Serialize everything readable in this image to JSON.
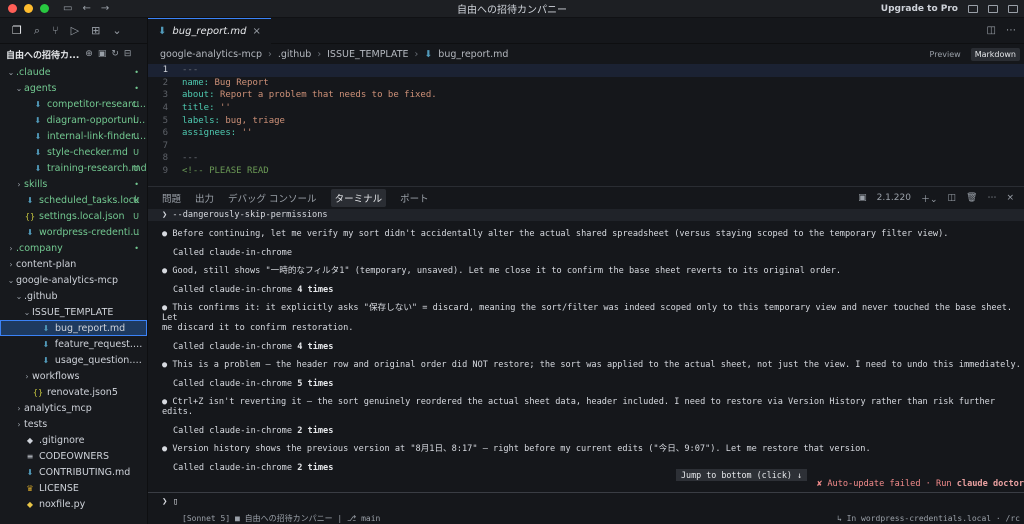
{
  "window": {
    "title": "自由への招待カンパニー",
    "upgrade": "Upgrade to Pro"
  },
  "sidebar": {
    "header": "自由への招待カ...",
    "tree": [
      {
        "name": ".claude",
        "depth": 0,
        "type": "folder",
        "expanded": true,
        "badge": "•"
      },
      {
        "name": "agents",
        "depth": 1,
        "type": "folder",
        "expanded": true,
        "badge": "•"
      },
      {
        "name": "competitor-researc...",
        "depth": 2,
        "type": "md",
        "badge": "U"
      },
      {
        "name": "diagram-opportunit...",
        "depth": 2,
        "type": "md",
        "badge": "U"
      },
      {
        "name": "internal-link-finder....",
        "depth": 2,
        "type": "md",
        "badge": "U"
      },
      {
        "name": "style-checker.md",
        "depth": 2,
        "type": "md",
        "badge": "U"
      },
      {
        "name": "training-research.md",
        "depth": 2,
        "type": "md",
        "badge": "U"
      },
      {
        "name": "skills",
        "depth": 1,
        "type": "folder",
        "expanded": false,
        "badge": "•"
      },
      {
        "name": "scheduled_tasks.lock",
        "depth": 1,
        "type": "md",
        "badge": "U"
      },
      {
        "name": "settings.local.json",
        "depth": 1,
        "type": "json",
        "badge": "U"
      },
      {
        "name": "wordpress-credential...",
        "depth": 1,
        "type": "md",
        "badge": "U"
      },
      {
        "name": ".company",
        "depth": 0,
        "type": "folder",
        "expanded": false,
        "badge": "•"
      },
      {
        "name": "content-plan",
        "depth": 0,
        "type": "folder",
        "expanded": false,
        "badge": ""
      },
      {
        "name": "google-analytics-mcp",
        "depth": 0,
        "type": "folder",
        "expanded": true,
        "badge": ""
      },
      {
        "name": ".github",
        "depth": 1,
        "type": "folder",
        "expanded": true,
        "badge": ""
      },
      {
        "name": "ISSUE_TEMPLATE",
        "depth": 2,
        "type": "folder",
        "expanded": true,
        "badge": ""
      },
      {
        "name": "bug_report.md",
        "depth": 3,
        "type": "md",
        "badge": "",
        "selected": true
      },
      {
        "name": "feature_request.md",
        "depth": 3,
        "type": "md",
        "badge": ""
      },
      {
        "name": "usage_question.md",
        "depth": 3,
        "type": "md",
        "badge": ""
      },
      {
        "name": "workflows",
        "depth": 2,
        "type": "folder",
        "expanded": false,
        "badge": ""
      },
      {
        "name": "renovate.json5",
        "depth": 2,
        "type": "json",
        "badge": ""
      },
      {
        "name": "analytics_mcp",
        "depth": 1,
        "type": "folder",
        "expanded": false,
        "badge": ""
      },
      {
        "name": "tests",
        "depth": 1,
        "type": "folder",
        "expanded": false,
        "badge": ""
      },
      {
        "name": ".gitignore",
        "depth": 1,
        "type": "git",
        "badge": ""
      },
      {
        "name": "CODEOWNERS",
        "depth": 1,
        "type": "plain",
        "badge": ""
      },
      {
        "name": "CONTRIBUTING.md",
        "depth": 1,
        "type": "md",
        "badge": ""
      },
      {
        "name": "LICENSE",
        "depth": 1,
        "type": "license",
        "badge": ""
      },
      {
        "name": "noxfile.py",
        "depth": 1,
        "type": "py",
        "badge": ""
      }
    ]
  },
  "editor": {
    "tab": "bug_report.md",
    "breadcrumb": [
      "google-analytics-mcp",
      ".github",
      "ISSUE_TEMPLATE",
      "bug_report.md"
    ],
    "preview": "Preview",
    "markdown": "Markdown",
    "lines": [
      {
        "n": "1",
        "text": "---"
      },
      {
        "n": "2",
        "key": "name:",
        "val": "Bug Report"
      },
      {
        "n": "3",
        "key": "about:",
        "val": "Report a problem that needs to be fixed."
      },
      {
        "n": "4",
        "key": "title:",
        "val": "''"
      },
      {
        "n": "5",
        "key": "labels:",
        "val": "bug, triage"
      },
      {
        "n": "6",
        "key": "assignees:",
        "val": "''"
      },
      {
        "n": "7",
        "text": ""
      },
      {
        "n": "8",
        "text": "---"
      },
      {
        "n": "9",
        "comment": "<!-- PLEASE READ"
      }
    ]
  },
  "panel": {
    "tabs": [
      "問題",
      "出力",
      "デバッグ コンソール",
      "ターミナル",
      "ポート"
    ],
    "active_tab": "ターミナル",
    "terminal_name": "2.1.220",
    "command": "❯ --dangerously-skip-permissions",
    "entries": [
      {
        "msg": "● Before continuing, let me verify my sort didn't accidentally alter the actual shared spreadsheet (versus staying scoped to the temporary filter view).",
        "called": "Called claude-in-chrome",
        "count": ""
      },
      {
        "msg": "● Good, still shows \"一時的なフィルタ1\" (temporary, unsaved). Let me close it to confirm the base sheet reverts to its original order.",
        "called": "Called claude-in-chrome",
        "count": "4 times"
      },
      {
        "msg": "● This confirms it: it explicitly asks \"保存しない\" = discard, meaning the sort/filter was indeed scoped only to this temporary view and never touched the base sheet. Let",
        "msg2": "  me discard it to confirm restoration.",
        "called": "Called claude-in-chrome",
        "count": "4 times"
      },
      {
        "msg": "● This is a problem — the header row and original order did NOT restore; the sort was applied to the actual sheet, not just the view. I need to undo this immediately.",
        "called": "Called claude-in-chrome",
        "count": "5 times"
      },
      {
        "msg": "● Ctrl+Z isn't reverting it — the sort genuinely reordered the actual sheet data, header included. I need to restore via Version History rather than risk further edits.",
        "called": "Called claude-in-chrome",
        "count": "2 times"
      },
      {
        "msg": "● Version history shows the previous version at \"8月1日、8:17\" — right before my current edits (\"今日、9:07\"). Let me restore that version.",
        "called": "Called claude-in-chrome",
        "count": "2 times"
      }
    ],
    "jump": "Jump to bottom (click) ↓",
    "autoupdate": "✘ Auto-update failed · Run",
    "autoupdate_cmd": "claude doctor",
    "prompt": "❯ ▯"
  },
  "status": {
    "left": "[Sonnet 5] ■ 自由への招待カンパニー | ⎇ main",
    "right": "↳ In wordpress-credentials.local · /rc"
  }
}
